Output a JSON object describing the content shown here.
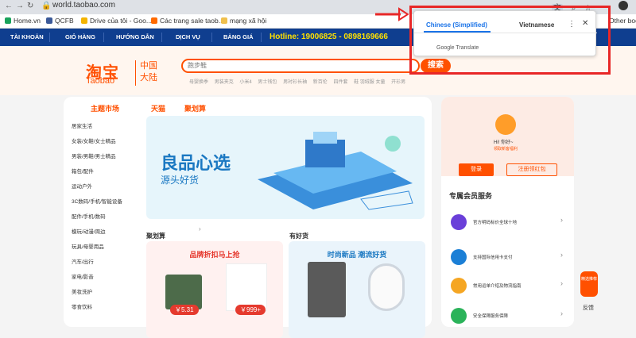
{
  "browser": {
    "url": "world.taobao.com",
    "bookmarks": [
      {
        "label": "Home.vn",
        "color": "#19a35b"
      },
      {
        "label": "QCFB",
        "color": "#3b5998"
      },
      {
        "label": "Drive của tôi - Goo...",
        "color": "#f4b400"
      },
      {
        "label": "Các trang sale taob...",
        "color": "#ff6a00"
      },
      {
        "label": "mạng xã hội",
        "color": "#f0c04d"
      }
    ],
    "other_bookmarks": "Other bookmar"
  },
  "top_nav": {
    "items": [
      "TÀI KHOẢN",
      "GIỎ HÀNG",
      "HƯỚNG DẪN",
      "DỊCH VỤ",
      "BẢNG GIÁ"
    ],
    "hotline": "Hotline: 19006825 - 0898169666"
  },
  "header": {
    "logo_cn": "淘宝",
    "logo_en": "Taobao",
    "region": "中国大陆",
    "search_placeholder": "跑步鞋",
    "search_button": "搜索",
    "hot_words": [
      "母婴换季",
      "男装夹克",
      "小米4",
      "男士钱包",
      "男衬衫长袖",
      "新百伦",
      "四件套",
      "鞋 羽绒服 女童",
      "开衫男"
    ]
  },
  "main": {
    "tabs": [
      "主题市场",
      "天猫",
      "聚划算"
    ],
    "categories": [
      "居家生活",
      "女装/女鞋/女士精品",
      "男装/男鞋/男士精品",
      "箱包/配件",
      "运动户外",
      "3C数码/手机/智能设备",
      "配件/手机/数码",
      "模玩/动漫/周边",
      "玩具/母婴用品",
      "汽车/出行",
      "家电/影音",
      "美妆洗护",
      "零食饮料"
    ],
    "banner_title": "良品心选",
    "banner_subtitle": "源头好货",
    "section1": {
      "title": "聚划算",
      "banner": "品牌折扣马上抢",
      "prices": [
        "￥5.31",
        "￥999+"
      ]
    },
    "section2": {
      "title": "有好货",
      "banner": "时尚新品 潮流好货"
    }
  },
  "right_panel": {
    "greeting": "Hi! 你好~",
    "benefit": "领取新客福利",
    "login": "登录",
    "register": "注册领红包",
    "member_title": "专属会员服务",
    "services": [
      {
        "text": "官方明码标价全球十地",
        "color": "#6a3fd9"
      },
      {
        "text": "支持国际信用卡支付",
        "color": "#1b7fd6"
      },
      {
        "text": "常用运单介绍及物流指南",
        "color": "#f5a623"
      },
      {
        "text": "安全保障服务保障",
        "color": "#2bb35a"
      }
    ]
  },
  "float": {
    "label": "精选推荐",
    "feedback": "反馈"
  },
  "translate_popup": {
    "tab_active": "Chinese (Simplified)",
    "tab_other": "Vietnamese",
    "brand": "Google Translate"
  }
}
